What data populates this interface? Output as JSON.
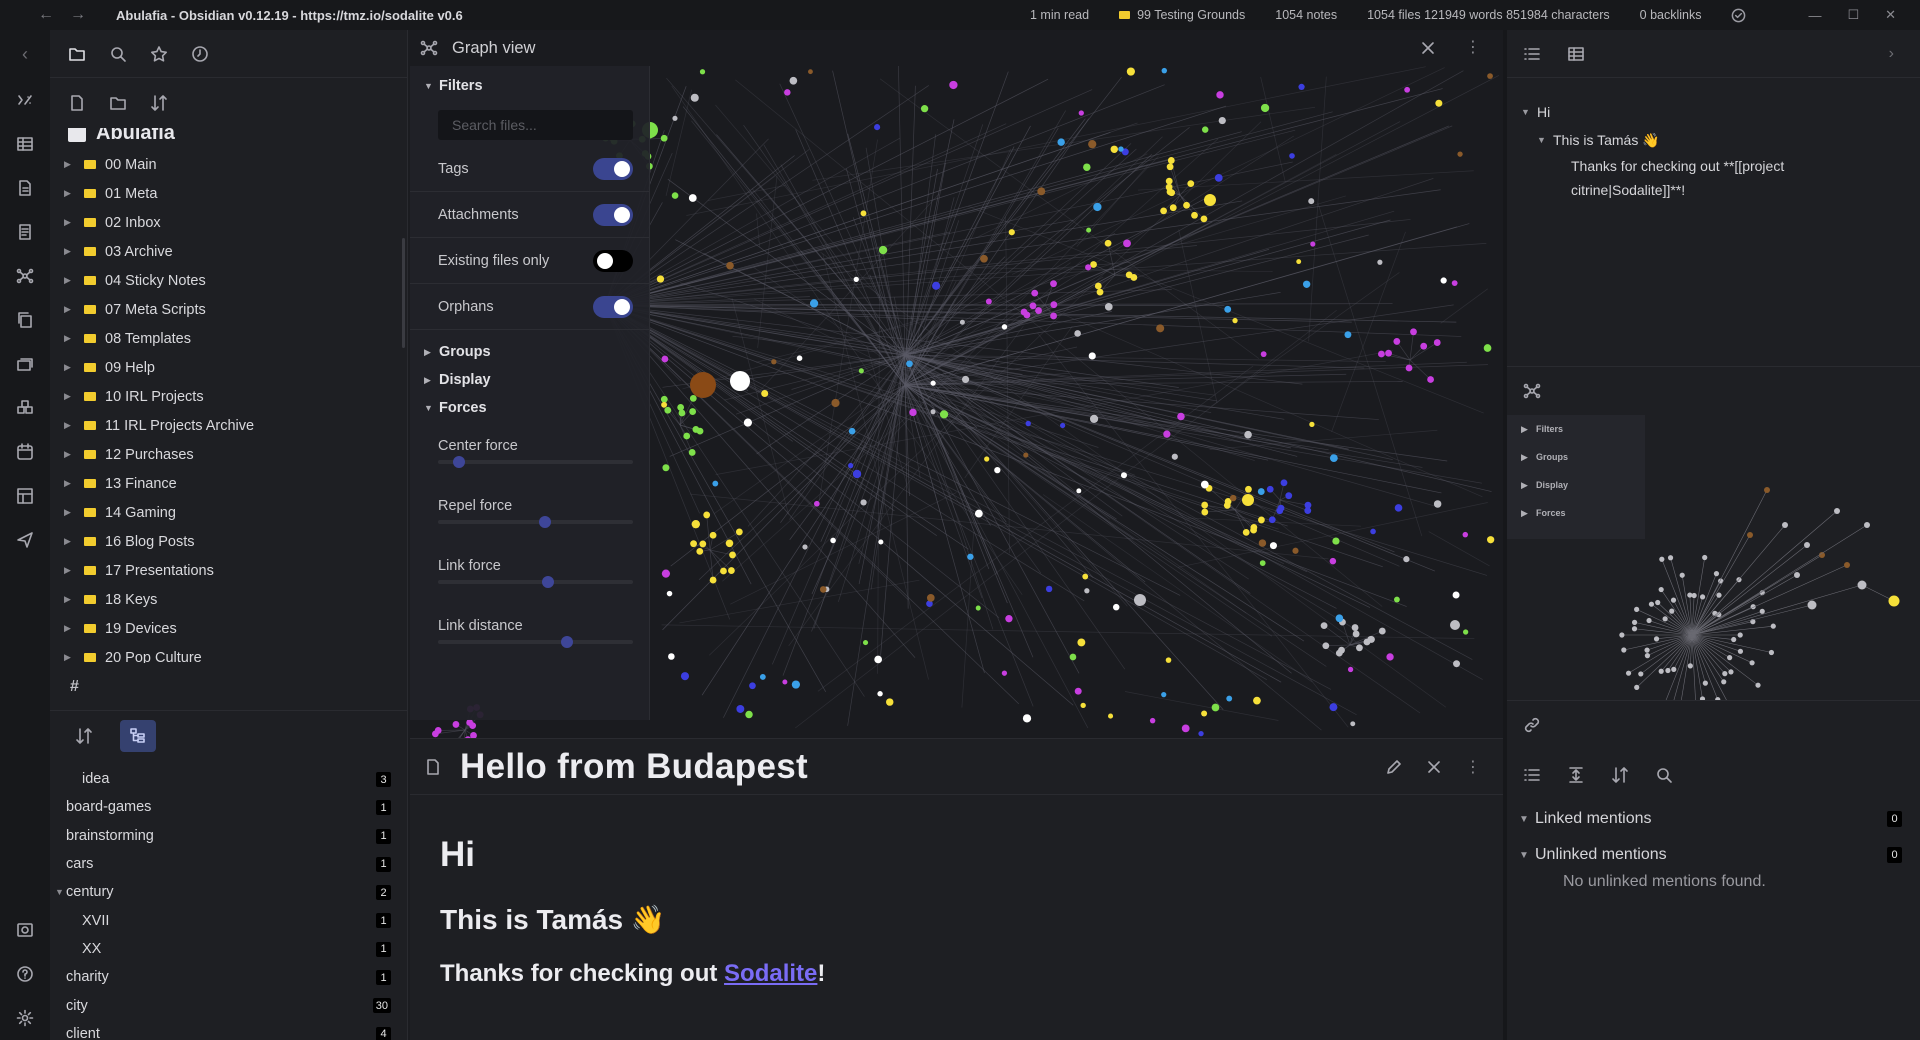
{
  "titlebar": {
    "title": "Abulafia - Obsidian v0.12.19 - https://tmz.io/sodalite v0.6",
    "read_time": "1 min read",
    "vault": "99 Testing Grounds",
    "notes": "1054 notes",
    "file_stats": "1054 files 121949 words 851984 characters",
    "backlinks": "0 backlinks"
  },
  "sidebar": {
    "vault_name": "Abulafia",
    "folders": [
      "00 Main",
      "01 Meta",
      "02 Inbox",
      "03 Archive",
      "04 Sticky Notes",
      "07 Meta Scripts",
      "08 Templates",
      "09 Help",
      "10 IRL Projects",
      "11 IRL Projects Archive",
      "12 Purchases",
      "13 Finance",
      "14 Gaming",
      "16 Blog Posts",
      "17 Presentations",
      "18 Keys",
      "19 Devices",
      "20 Pop Culture"
    ],
    "tag_header": "#",
    "tags": [
      {
        "name": "idea",
        "count": "3",
        "indent": 2,
        "arrow": ""
      },
      {
        "name": "board-games",
        "count": "1",
        "indent": 1,
        "arrow": ""
      },
      {
        "name": "brainstorming",
        "count": "1",
        "indent": 1,
        "arrow": ""
      },
      {
        "name": "cars",
        "count": "1",
        "indent": 1,
        "arrow": ""
      },
      {
        "name": "century",
        "count": "2",
        "indent": 1,
        "arrow": "▼"
      },
      {
        "name": "XVII",
        "count": "1",
        "indent": 2,
        "arrow": ""
      },
      {
        "name": "XX",
        "count": "1",
        "indent": 2,
        "arrow": ""
      },
      {
        "name": "charity",
        "count": "1",
        "indent": 1,
        "arrow": ""
      },
      {
        "name": "city",
        "count": "30",
        "indent": 1,
        "arrow": ""
      },
      {
        "name": "client",
        "count": "4",
        "indent": 1,
        "arrow": ""
      }
    ]
  },
  "graph": {
    "title": "Graph view",
    "filters_label": "Filters",
    "search_placeholder": "Search files...",
    "toggles": [
      {
        "label": "Tags",
        "on": true
      },
      {
        "label": "Attachments",
        "on": true
      },
      {
        "label": "Existing files only",
        "on": false
      },
      {
        "label": "Orphans",
        "on": true
      }
    ],
    "groups_label": "Groups",
    "display_label": "Display",
    "forces_label": "Forces",
    "forces": [
      {
        "label": "Center force",
        "value": 0.08
      },
      {
        "label": "Repel force",
        "value": 0.55
      },
      {
        "label": "Link force",
        "value": 0.57
      },
      {
        "label": "Link distance",
        "value": 0.67
      }
    ]
  },
  "note": {
    "title": "Hello from Budapest",
    "h1": "Hi",
    "h2": "This is Tamás 👋",
    "p_prefix": "Thanks for checking out ",
    "link": "Sodalite",
    "p_suffix": "!"
  },
  "outline": {
    "h1": "Hi",
    "h2": "This is Tamás 👋",
    "text": "Thanks for checking out **[[project citrine|Sodalite]]**!"
  },
  "local_graph": {
    "sections": [
      "Filters",
      "Groups",
      "Display",
      "Forces"
    ]
  },
  "backlinks": {
    "linked_label": "Linked mentions",
    "linked_count": "0",
    "unlinked_label": "Unlinked mentions",
    "unlinked_count": "0",
    "empty_text": "No unlinked mentions found."
  },
  "colors": {
    "accent": "#3a4590",
    "folder": "#f2cc2e",
    "link": "#7a6cf5",
    "node_white": "#ffffff",
    "node_green": "#7ee04a",
    "node_yellow": "#f6e03a",
    "node_magenta": "#c83ee0",
    "node_blue": "#3c3ee0",
    "node_orange": "#8a5a2a",
    "node_cyan": "#3aa0e8",
    "node_gray": "#bdbdc3"
  }
}
